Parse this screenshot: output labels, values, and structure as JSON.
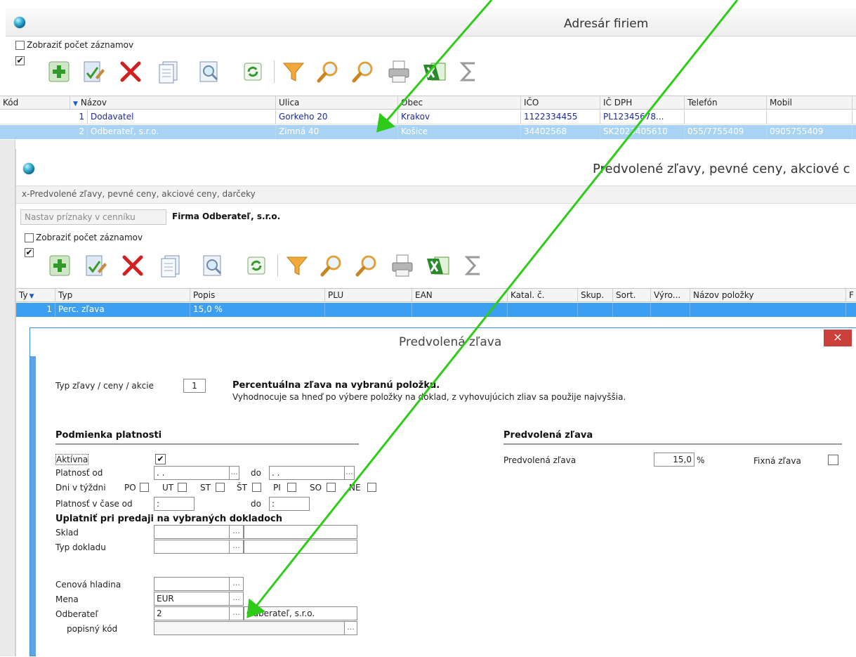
{
  "window1": {
    "title": "Adresár firiem",
    "show_count_label": "Zobraziť počet záznamov",
    "columns": [
      "Kód",
      "Názov",
      "Ulica",
      "Obec",
      "IČO",
      "IČ DPH",
      "Telefón",
      "Mobil"
    ],
    "rows": [
      {
        "kod": "1",
        "nazov": "Dodavatel",
        "ulica": "Gorkeho 20",
        "obec": "Krakov",
        "ico": "1122334455",
        "icdph": "PL12345678...",
        "telefon": "",
        "mobil": ""
      },
      {
        "kod": "2",
        "nazov": "Odberateľ, s.r.o.",
        "ulica": "Zimná 40",
        "obec": "Košice",
        "ico": "34402568",
        "icdph": "SK2023405610",
        "telefon": "055/7755409",
        "mobil": "0905755409"
      }
    ]
  },
  "window2": {
    "title": "Predvolené zľavy, pevné ceny, akciové c",
    "subtitle": "x-Predvolené zľavy, pevné ceny, akciové ceny, darčeky",
    "set_flags_button": "Nastav príznaky v cenníku",
    "firm_label": "Firma  Odberateľ, s.r.o.",
    "show_count_label": "Zobraziť počet záznamov",
    "columns": [
      "Ty",
      "Typ",
      "Popis",
      "PLU",
      "EAN",
      "Katal. č.",
      "Skup.",
      "Sort.",
      "Výro...",
      "Názov položky",
      "F"
    ],
    "rows": [
      {
        "ty": "1",
        "typ": "Perc. zľava",
        "popis": "15,0 %"
      }
    ]
  },
  "dialog": {
    "title": "Predvolená zľava",
    "close": "×",
    "typ_label": "Typ zľavy / ceny / akcie",
    "typ_value": "1",
    "desc_bold": "Percentuálna zľava na vybranú položku.",
    "desc_text": "Vyhodnocuje sa hneď po výbere položky na doklad, z vyhovujúcich zliav sa použije najvyššia.",
    "section_validity": "Podmienka platnosti",
    "aktivna": "Aktívna",
    "platnost_od": "Platnosť od",
    "date_placeholder": " .  .",
    "do": "do",
    "dni_label": "Dni v týždni",
    "days": [
      "PO",
      "UT",
      "ST",
      "ŠT",
      "PI",
      "SO",
      "NE"
    ],
    "cas_label": "Platnosť v čase od",
    "time_placeholder": " :",
    "section_docs": "Uplatniť pri predaji na vybraných dokladoch",
    "sklad": "Sklad",
    "typ_dokladu": "Typ dokladu",
    "cenova_hladina": "Cenová hladina",
    "mena": "Mena",
    "mena_value": "EUR",
    "odberatel": "Odberateľ",
    "odberatel_value": "2",
    "odberatel_name": "Odberateľ, s.r.o.",
    "popisny_kod": "popisný kód",
    "ellipsis": "...",
    "section_discount": "Predvolená zľava",
    "discount_label": "Predvolená zľava",
    "discount_value": "15,0",
    "percent": "%",
    "fixed_label": "Fixná zľava"
  },
  "colors": {
    "selection": "#3d9ff0",
    "selection_light": "#a8d3f4",
    "arrow": "#2ecc18",
    "close_button": "#c9413a",
    "link_text": "#1e2a9a"
  }
}
